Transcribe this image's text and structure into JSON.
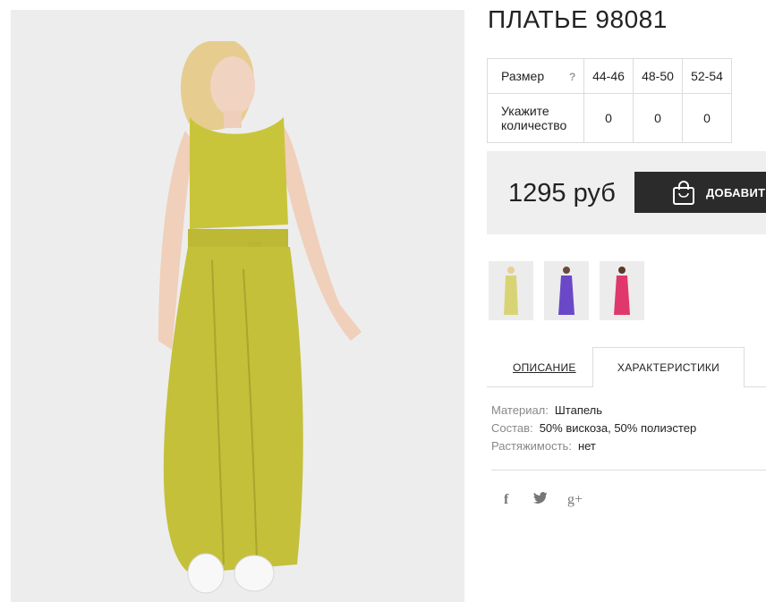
{
  "product": {
    "title": "ПЛАТЬЕ 98081",
    "image_alt": "Женщина в длинном платье горчичного цвета"
  },
  "size_table": {
    "size_label": "Размер",
    "help_icon": "?",
    "sizes": [
      "44-46",
      "48-50",
      "52-54"
    ],
    "quantity_label_line1": "Укажите",
    "quantity_label_line2": "количество",
    "quantities": [
      "0",
      "0",
      "0"
    ]
  },
  "purchase": {
    "price": "1295 руб",
    "add_button_label": "ДОБАВИТЬ",
    "add_button_icon": "shopping-bag-icon"
  },
  "thumbnails": [
    {
      "name": "yellow",
      "color": "#d8d476"
    },
    {
      "name": "purple",
      "color": "#6b48c8"
    },
    {
      "name": "pink",
      "color": "#e0386c"
    }
  ],
  "tabs": {
    "description": "ОПИСАНИЕ",
    "characteristics": "ХАРАКТЕРИСТИКИ",
    "active": "characteristics"
  },
  "characteristics": [
    {
      "key": "Материал:",
      "value": "Штапель"
    },
    {
      "key": "Состав:",
      "value": "50% вискоза, 50% полиэстер"
    },
    {
      "key": "Растяжимость:",
      "value": "нет"
    }
  ],
  "social": [
    {
      "name": "facebook-icon",
      "glyph": "f"
    },
    {
      "name": "twitter-icon",
      "glyph": "🐦"
    },
    {
      "name": "google-plus-icon",
      "glyph": "g+"
    }
  ],
  "colors": {
    "dress": "#c6c23a",
    "button_bg": "#2b2b2b",
    "price_bar_bg": "#efefef"
  }
}
